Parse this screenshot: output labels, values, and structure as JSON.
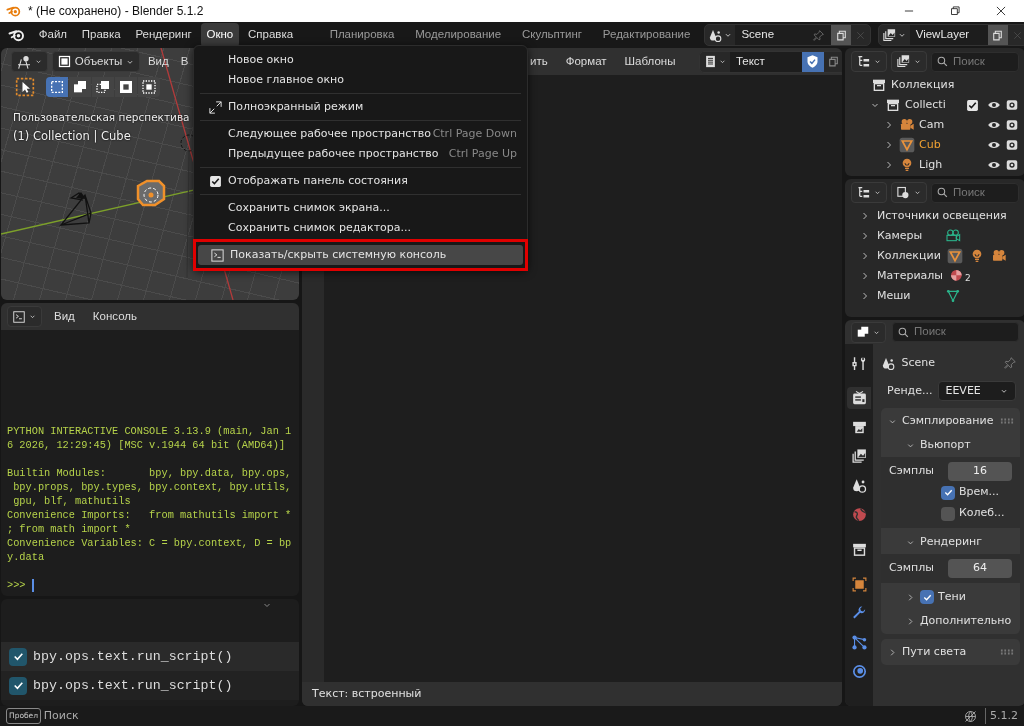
{
  "window": {
    "title": "* (Не сохранено) - Blender 5.1.2"
  },
  "menubar": {
    "menus": [
      {
        "label": "Файл",
        "selected": false
      },
      {
        "label": "Правка",
        "selected": false
      },
      {
        "label": "Рендеринг",
        "selected": false
      },
      {
        "label": "Окно",
        "selected": true
      },
      {
        "label": "Справка",
        "selected": false
      }
    ],
    "workspaces": [
      {
        "label": "Планировка",
        "selected": false
      },
      {
        "label": "Моделирование",
        "selected": false
      },
      {
        "label": "Скульптинг",
        "selected": false
      },
      {
        "label": "Редактирование",
        "selected": false
      }
    ],
    "scene": "Scene",
    "view_layer": "ViewLayer"
  },
  "window_menu": {
    "groups": [
      [
        {
          "kind": "plain",
          "label": "Новое окно",
          "highlighted": false,
          "outlined": false
        },
        {
          "kind": "plain",
          "label": "Новое главное окно",
          "highlighted": false,
          "outlined": false
        }
      ],
      [
        {
          "kind": "fullscreen",
          "label": "Полноэкранный режим",
          "highlighted": false,
          "outlined": false
        }
      ],
      [
        {
          "kind": "plain",
          "label": "Следующее рабочее пространство",
          "shortcut": "Ctrl Page Down",
          "highlighted": false,
          "outlined": false
        },
        {
          "kind": "plain",
          "label": "Предыдущее рабочее пространство",
          "shortcut": "Ctrl Page Up",
          "highlighted": false,
          "outlined": false
        }
      ],
      [
        {
          "kind": "check",
          "label": "Отображать панель состояния",
          "checked": true,
          "highlighted": false,
          "outlined": false
        }
      ],
      [
        {
          "kind": "plain",
          "label": "Сохранить снимок экрана...",
          "highlighted": false,
          "outlined": false
        },
        {
          "kind": "plain",
          "label": "Сохранить снимок редактора...",
          "highlighted": false,
          "outlined": false
        }
      ],
      [
        {
          "kind": "console",
          "label": "Показать/скрыть системную консоль",
          "highlighted": true,
          "outlined": true
        }
      ]
    ]
  },
  "viewport": {
    "mode": "Объекты",
    "menus": [
      "Вид",
      "В"
    ],
    "select_modes": [
      {
        "selected": true
      },
      {
        "selected": false
      },
      {
        "selected": false
      },
      {
        "selected": false
      },
      {
        "selected": false
      }
    ],
    "view_name": "Пользовательская перспектива",
    "context": "(1) Collection | Cube"
  },
  "console": {
    "menus": [
      "Вид",
      "Консоль"
    ],
    "blocks": [
      [
        "PYTHON INTERACTIVE CONSOLE 3.13.9 (main, Jan 1",
        "6 2026, 12:29:45) [MSC v.1944 64 bit (AMD64)]"
      ],
      [
        "Builtin Modules:       bpy, bpy.data, bpy.ops,",
        " bpy.props, bpy.types, bpy.context, bpy.utils,",
        " gpu, blf, mathutils",
        "Convenience Imports:   from mathutils import *",
        "; from math import *",
        "Convenience Variables: C = bpy.context, D = bp",
        "y.data"
      ]
    ],
    "prompt": ">>>"
  },
  "info": {
    "reports": [
      {
        "text": "bpy.ops.text.run_script()"
      },
      {
        "text": "bpy.ops.text.run_script()"
      }
    ]
  },
  "text_editor": {
    "menus": [
      "ить",
      "Формат",
      "Шаблоны"
    ],
    "datablock": "Текст",
    "fake_user": true,
    "footer": "Текст: встроенный"
  },
  "outliner": {
    "search_placeholder": "Поиск",
    "items": [
      {
        "label": "Коллекция",
        "kind": "scene_collection",
        "children": [
          {
            "label": "Collecti",
            "kind": "collection",
            "expanded": true,
            "checked": true,
            "children": [
              {
                "label": "Cam",
                "kind": "camera",
                "expanded": false,
                "selected": false
              },
              {
                "label": "Cub",
                "kind": "mesh",
                "expanded": false,
                "selected": true
              },
              {
                "label": "Ligh",
                "kind": "light",
                "expanded": false,
                "selected": false
              }
            ]
          }
        ]
      }
    ]
  },
  "blend_file": {
    "search_placeholder": "Поиск",
    "items": [
      {
        "label": "Источники освещения",
        "kind": "lights",
        "expanded": false
      },
      {
        "label": "Камеры",
        "kind": "cameras",
        "expanded": false
      },
      {
        "label": "Коллекции",
        "kind": "collections",
        "expanded": false
      },
      {
        "label": "Материалы",
        "kind": "materials",
        "expanded": false,
        "count": "2"
      },
      {
        "label": "Меши",
        "kind": "meshes",
        "expanded": false
      }
    ]
  },
  "properties": {
    "search_placeholder": "Поиск",
    "tabs": [
      {
        "kind": "tool",
        "selected": false
      },
      {
        "kind": "render",
        "selected": true
      },
      {
        "kind": "output",
        "selected": false
      },
      {
        "kind": "view_layer",
        "selected": false
      },
      {
        "kind": "scene",
        "selected": false
      },
      {
        "kind": "world",
        "selected": false
      },
      {
        "kind": "collection",
        "selected": false
      },
      {
        "kind": "object",
        "selected": false
      },
      {
        "kind": "modifiers",
        "selected": false
      },
      {
        "kind": "particles",
        "selected": false
      },
      {
        "kind": "physics",
        "selected": false
      }
    ],
    "context": "Scene",
    "engine_label": "Ренде...",
    "engine": "EEVEE",
    "panels": [
      {
        "label": "Сэмплирование",
        "expanded": true,
        "subpanels": [
          {
            "label": "Вьюпорт",
            "expanded": true,
            "rows": [
              {
                "kind": "number",
                "label": "Сэмплы",
                "value": "16"
              },
              {
                "kind": "check",
                "label": "Врем...",
                "checked": true
              },
              {
                "kind": "check",
                "label": "Колеб...",
                "checked": false
              }
            ]
          },
          {
            "label": "Рендеринг",
            "expanded": true,
            "rows": [
              {
                "kind": "number",
                "label": "Сэмплы",
                "value": "64"
              }
            ]
          },
          {
            "label": "Тени",
            "expanded": false,
            "checked": true
          },
          {
            "label": "Дополнительно",
            "expanded": false
          }
        ]
      },
      {
        "label": "Пути света",
        "expanded": false
      }
    ]
  },
  "status_bar": {
    "key": "Пробел",
    "action": "Поиск",
    "version": "5.1.2"
  }
}
